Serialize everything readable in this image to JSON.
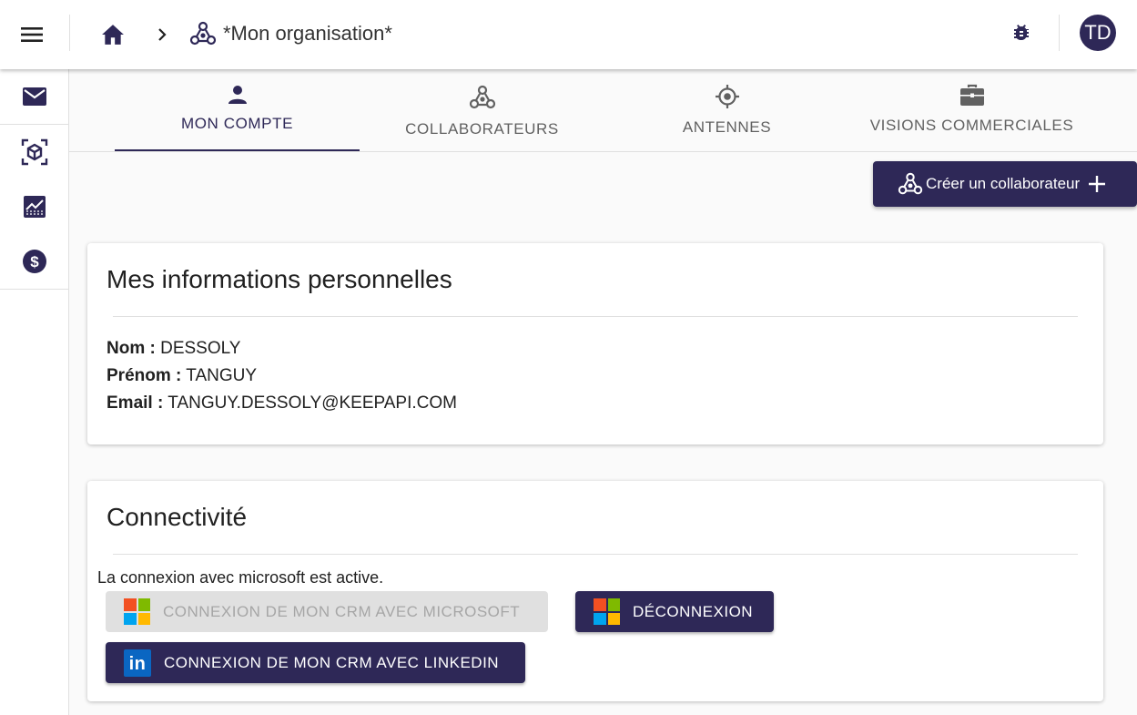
{
  "header": {
    "breadcrumb_current": "*Mon organisation*",
    "avatar_initials": "TD"
  },
  "sidebar": {
    "items": [
      {
        "icon": "mail-icon"
      },
      {
        "icon": "cube-scan-icon"
      },
      {
        "icon": "chart-icon"
      },
      {
        "icon": "dollar-icon"
      }
    ]
  },
  "tabs": [
    {
      "label": "MON COMPTE",
      "icon": "person-icon",
      "active": true
    },
    {
      "label": "COLLABORATEURS",
      "icon": "collaborators-icon",
      "active": false
    },
    {
      "label": "ANTENNES",
      "icon": "target-icon",
      "active": false
    },
    {
      "label": "VISIONS COMMERCIALES",
      "icon": "briefcase-icon",
      "active": false
    }
  ],
  "actions": {
    "create_label": "Créer un collaborateur"
  },
  "personal": {
    "title": "Mes informations personnelles",
    "nom_label": "Nom :",
    "nom_value": "DESSOLY",
    "prenom_label": "Prénom :",
    "prenom_value": "TANGUY",
    "email_label": "Email :",
    "email_value": "TANGUY.DESSOLY@KEEPAPI.COM"
  },
  "connectivity": {
    "title": "Connectivité",
    "status": "La connexion avec microsoft est active.",
    "ms_connect_label": "CONNEXION DE MON CRM AVEC MICROSOFT",
    "ms_disconnect_label": "DÉCONNEXION",
    "linkedin_label": "CONNEXION DE MON CRM AVEC LINKEDIN",
    "linkedin_logo_text": "in"
  },
  "colors": {
    "primary": "#2e2857",
    "ms_red": "#f25022",
    "ms_green": "#7fba00",
    "ms_blue": "#00a4ef",
    "ms_yellow": "#ffb900",
    "linkedin": "#0a66c2"
  }
}
